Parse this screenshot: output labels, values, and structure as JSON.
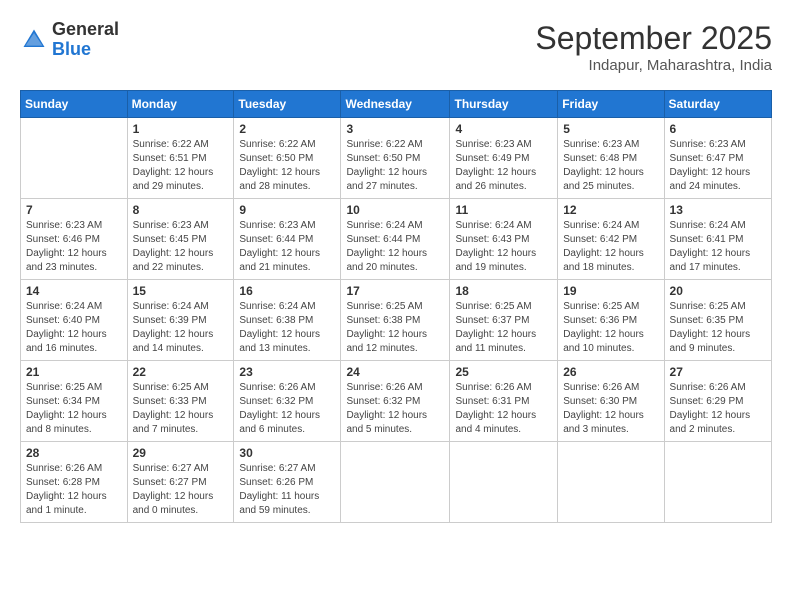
{
  "logo": {
    "general": "General",
    "blue": "Blue"
  },
  "title": "September 2025",
  "subtitle": "Indapur, Maharashtra, India",
  "days_of_week": [
    "Sunday",
    "Monday",
    "Tuesday",
    "Wednesday",
    "Thursday",
    "Friday",
    "Saturday"
  ],
  "weeks": [
    [
      {
        "day": "",
        "info": ""
      },
      {
        "day": "1",
        "info": "Sunrise: 6:22 AM\nSunset: 6:51 PM\nDaylight: 12 hours\nand 29 minutes."
      },
      {
        "day": "2",
        "info": "Sunrise: 6:22 AM\nSunset: 6:50 PM\nDaylight: 12 hours\nand 28 minutes."
      },
      {
        "day": "3",
        "info": "Sunrise: 6:22 AM\nSunset: 6:50 PM\nDaylight: 12 hours\nand 27 minutes."
      },
      {
        "day": "4",
        "info": "Sunrise: 6:23 AM\nSunset: 6:49 PM\nDaylight: 12 hours\nand 26 minutes."
      },
      {
        "day": "5",
        "info": "Sunrise: 6:23 AM\nSunset: 6:48 PM\nDaylight: 12 hours\nand 25 minutes."
      },
      {
        "day": "6",
        "info": "Sunrise: 6:23 AM\nSunset: 6:47 PM\nDaylight: 12 hours\nand 24 minutes."
      }
    ],
    [
      {
        "day": "7",
        "info": "Sunrise: 6:23 AM\nSunset: 6:46 PM\nDaylight: 12 hours\nand 23 minutes."
      },
      {
        "day": "8",
        "info": "Sunrise: 6:23 AM\nSunset: 6:45 PM\nDaylight: 12 hours\nand 22 minutes."
      },
      {
        "day": "9",
        "info": "Sunrise: 6:23 AM\nSunset: 6:44 PM\nDaylight: 12 hours\nand 21 minutes."
      },
      {
        "day": "10",
        "info": "Sunrise: 6:24 AM\nSunset: 6:44 PM\nDaylight: 12 hours\nand 20 minutes."
      },
      {
        "day": "11",
        "info": "Sunrise: 6:24 AM\nSunset: 6:43 PM\nDaylight: 12 hours\nand 19 minutes."
      },
      {
        "day": "12",
        "info": "Sunrise: 6:24 AM\nSunset: 6:42 PM\nDaylight: 12 hours\nand 18 minutes."
      },
      {
        "day": "13",
        "info": "Sunrise: 6:24 AM\nSunset: 6:41 PM\nDaylight: 12 hours\nand 17 minutes."
      }
    ],
    [
      {
        "day": "14",
        "info": "Sunrise: 6:24 AM\nSunset: 6:40 PM\nDaylight: 12 hours\nand 16 minutes."
      },
      {
        "day": "15",
        "info": "Sunrise: 6:24 AM\nSunset: 6:39 PM\nDaylight: 12 hours\nand 14 minutes."
      },
      {
        "day": "16",
        "info": "Sunrise: 6:24 AM\nSunset: 6:38 PM\nDaylight: 12 hours\nand 13 minutes."
      },
      {
        "day": "17",
        "info": "Sunrise: 6:25 AM\nSunset: 6:38 PM\nDaylight: 12 hours\nand 12 minutes."
      },
      {
        "day": "18",
        "info": "Sunrise: 6:25 AM\nSunset: 6:37 PM\nDaylight: 12 hours\nand 11 minutes."
      },
      {
        "day": "19",
        "info": "Sunrise: 6:25 AM\nSunset: 6:36 PM\nDaylight: 12 hours\nand 10 minutes."
      },
      {
        "day": "20",
        "info": "Sunrise: 6:25 AM\nSunset: 6:35 PM\nDaylight: 12 hours\nand 9 minutes."
      }
    ],
    [
      {
        "day": "21",
        "info": "Sunrise: 6:25 AM\nSunset: 6:34 PM\nDaylight: 12 hours\nand 8 minutes."
      },
      {
        "day": "22",
        "info": "Sunrise: 6:25 AM\nSunset: 6:33 PM\nDaylight: 12 hours\nand 7 minutes."
      },
      {
        "day": "23",
        "info": "Sunrise: 6:26 AM\nSunset: 6:32 PM\nDaylight: 12 hours\nand 6 minutes."
      },
      {
        "day": "24",
        "info": "Sunrise: 6:26 AM\nSunset: 6:32 PM\nDaylight: 12 hours\nand 5 minutes."
      },
      {
        "day": "25",
        "info": "Sunrise: 6:26 AM\nSunset: 6:31 PM\nDaylight: 12 hours\nand 4 minutes."
      },
      {
        "day": "26",
        "info": "Sunrise: 6:26 AM\nSunset: 6:30 PM\nDaylight: 12 hours\nand 3 minutes."
      },
      {
        "day": "27",
        "info": "Sunrise: 6:26 AM\nSunset: 6:29 PM\nDaylight: 12 hours\nand 2 minutes."
      }
    ],
    [
      {
        "day": "28",
        "info": "Sunrise: 6:26 AM\nSunset: 6:28 PM\nDaylight: 12 hours\nand 1 minute."
      },
      {
        "day": "29",
        "info": "Sunrise: 6:27 AM\nSunset: 6:27 PM\nDaylight: 12 hours\nand 0 minutes."
      },
      {
        "day": "30",
        "info": "Sunrise: 6:27 AM\nSunset: 6:26 PM\nDaylight: 11 hours\nand 59 minutes."
      },
      {
        "day": "",
        "info": ""
      },
      {
        "day": "",
        "info": ""
      },
      {
        "day": "",
        "info": ""
      },
      {
        "day": "",
        "info": ""
      }
    ]
  ]
}
